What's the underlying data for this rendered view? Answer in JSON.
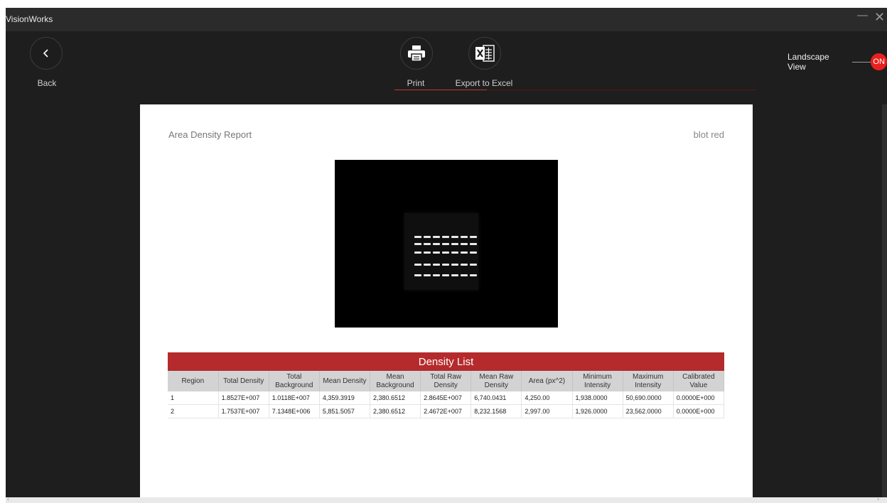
{
  "window": {
    "title": "VisionWorks"
  },
  "toolbar": {
    "back_label": "Back",
    "print_label": "Print",
    "export_label": "Export to Excel",
    "landscape_label": "Landscape View",
    "landscape_toggle": "ON",
    "accent_color": "#e8211e"
  },
  "report": {
    "title": "Area Density Report",
    "image_name": "blot red",
    "density_title": "Density List",
    "columns": [
      "Region",
      "Total Density",
      "Total Background",
      "Mean Density",
      "Mean Background",
      "Total Raw Density",
      "Mean Raw Density",
      "Area (px^2)",
      "Minimum Intensity",
      "Maximum Intensity",
      "Calibrated Value"
    ],
    "rows": [
      [
        "1",
        "1.8527E+007",
        "1.0118E+007",
        "4,359.3919",
        "2,380.6512",
        "2.8645E+007",
        "6,740.0431",
        "4,250.00",
        "1,938.0000",
        "50,690.0000",
        "0.0000E+000"
      ],
      [
        "2",
        "1.7537E+007",
        "7.1348E+006",
        "5,851.5057",
        "2,380.6512",
        "2.4672E+007",
        "8,232.1568",
        "2,997.00",
        "1,926.0000",
        "23,562.0000",
        "0.0000E+000"
      ]
    ]
  },
  "icons": {
    "back": "chevron-left-icon",
    "print": "printer-icon",
    "excel": "excel-icon"
  }
}
